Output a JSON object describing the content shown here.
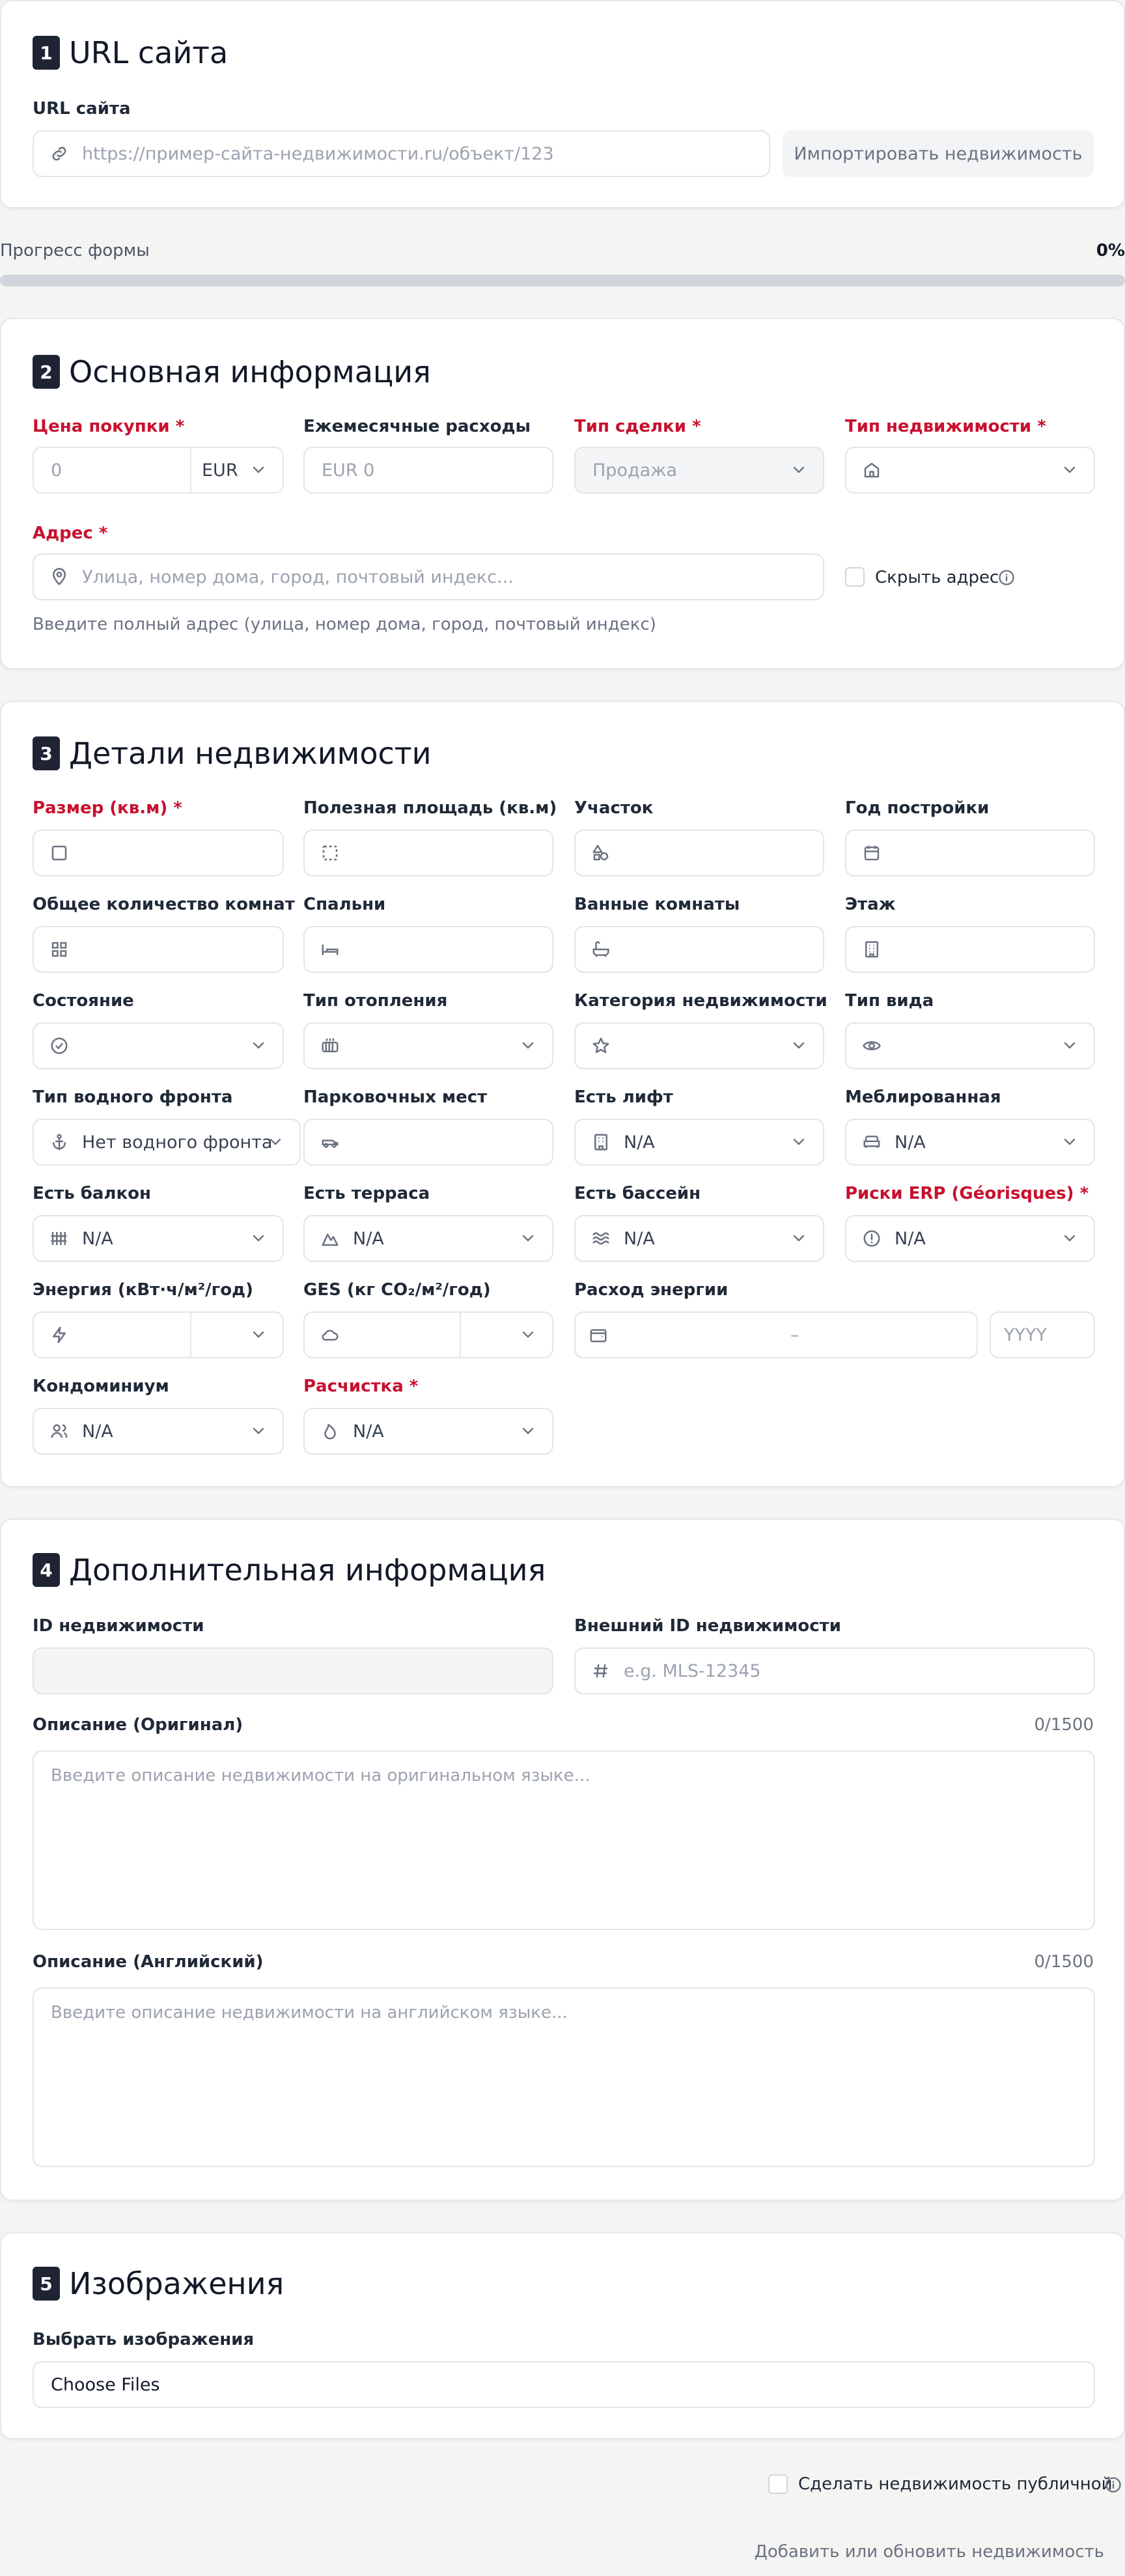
{
  "s1": {
    "num": "1",
    "title": "URL сайта",
    "url_label": "URL сайта",
    "url_placeholder": "https://пример-сайта-недвижимости.ru/объект/123",
    "import_button": "Импортировать недвижимость"
  },
  "progress": {
    "label": "Прогресс формы",
    "value_text": "0%",
    "value": 0
  },
  "s2": {
    "num": "2",
    "title": "Основная информация",
    "price_label": "Цена покупки *",
    "price_placeholder": "0",
    "currency": "EUR",
    "monthly_label": "Ежемесячные расходы",
    "monthly_placeholder": "EUR 0",
    "deal_label": "Тип сделки *",
    "deal_value": "Продажа",
    "proptype_label": "Тип недвижимости *",
    "address_label": "Адрес *",
    "address_placeholder": "Улица, номер дома, город, почтовый индекс...",
    "hide_label": "Скрыть адрес",
    "address_help": "Введите полный адрес (улица, номер дома, город, почтовый индекс)"
  },
  "s3": {
    "num": "3",
    "title": "Детали недвижимости",
    "size_label": "Размер (кв.м) *",
    "usable_label": "Полезная площадь (кв.м)",
    "plot_label": "Участок",
    "year_label": "Год постройки",
    "rooms_label": "Общее количество комнат",
    "bedrooms_label": "Спальни",
    "bathrooms_label": "Ванные комнаты",
    "floor_label": "Этаж",
    "condition_label": "Состояние",
    "heating_label": "Тип отопления",
    "category_label": "Категория недвижимости",
    "view_label": "Тип вида",
    "waterfront_label": "Тип водного фронта",
    "waterfront_value": "Нет водного фронта",
    "parking_label": "Парковочных мест",
    "elevator_label": "Есть лифт",
    "elevator_value": "N/A",
    "furnished_label": "Меблированная",
    "furnished_value": "N/A",
    "balcony_label": "Есть балкон",
    "balcony_value": "N/A",
    "terrace_label": "Есть терраса",
    "terrace_value": "N/A",
    "pool_label": "Есть бассейн",
    "pool_value": "N/A",
    "erp_label": "Риски ERP (Géorisques) *",
    "erp_value": "N/A",
    "energy_label": "Энергия (кВт·ч/м²/год)",
    "ges_label": "GES (кг CO₂/м²/год)",
    "consumption_label": "Расход энергии",
    "range_dash": "–",
    "year_placeholder": "YYYY",
    "condo_label": "Кондоминиум",
    "condo_value": "N/A",
    "clearing_label": "Расчистка *",
    "clearing_value": "N/A"
  },
  "s4": {
    "num": "4",
    "title": "Дополнительная информация",
    "id_label": "ID недвижимости",
    "extid_label": "Внешний ID недвижимости",
    "extid_placeholder": "e.g. MLS-12345",
    "desc_orig_label": "Описание (Оригинал)",
    "desc_orig_count": "0/1500",
    "desc_orig_placeholder": "Введите описание недвижимости на оригинальном языке...",
    "desc_en_label": "Описание (Английский)",
    "desc_en_count": "0/1500",
    "desc_en_placeholder": "Введите описание недвижимости на английском языке..."
  },
  "s5": {
    "num": "5",
    "title": "Изображения",
    "images_label": "Выбрать изображения",
    "choose_files": "Choose Files"
  },
  "footer": {
    "public_label": "Сделать недвижимость публичной",
    "submit": "Добавить или обновить недвижимость"
  }
}
